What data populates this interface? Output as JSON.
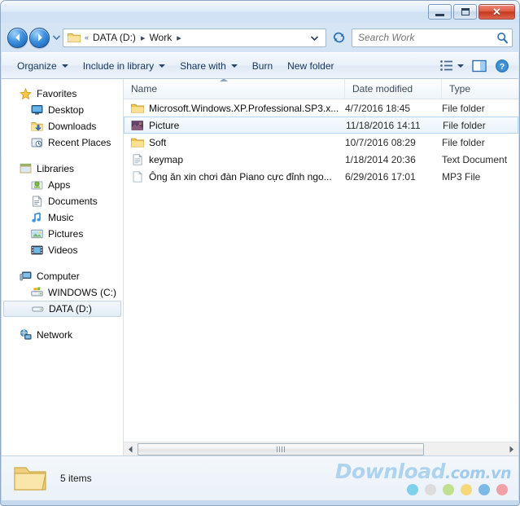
{
  "window": {
    "controls": {
      "minimize": "Minimize",
      "maximize": "Maximize",
      "close": "✕"
    }
  },
  "address": {
    "back_label": "Back",
    "forward_label": "Forward",
    "recent_pages_label": "Recent pages",
    "folder_icon": "folder-icon",
    "overflow": "«",
    "crumbs": [
      {
        "label": "DATA (D:)"
      },
      {
        "label": "Work"
      }
    ],
    "separator": "▸",
    "dropdown_label": "Previous locations",
    "refresh_label": "Refresh"
  },
  "search": {
    "placeholder": "Search Work",
    "value": "",
    "icon": "search-icon"
  },
  "toolbar": {
    "items": [
      {
        "label": "Organize",
        "has_caret": true
      },
      {
        "label": "Include in library",
        "has_caret": true
      },
      {
        "label": "Share with",
        "has_caret": true
      },
      {
        "label": "Burn",
        "has_caret": false
      },
      {
        "label": "New folder",
        "has_caret": false
      }
    ],
    "view_label": "Change your view",
    "preview_label": "Show the preview pane",
    "help_label": "Get help"
  },
  "sidebar": {
    "groups": [
      {
        "header": {
          "label": "Favorites",
          "icon": "star-icon"
        },
        "items": [
          {
            "label": "Desktop",
            "icon": "desktop-icon"
          },
          {
            "label": "Downloads",
            "icon": "downloads-icon"
          },
          {
            "label": "Recent Places",
            "icon": "recent-places-icon"
          }
        ]
      },
      {
        "header": {
          "label": "Libraries",
          "icon": "libraries-icon"
        },
        "items": [
          {
            "label": "Apps",
            "icon": "apps-icon"
          },
          {
            "label": "Documents",
            "icon": "documents-icon"
          },
          {
            "label": "Music",
            "icon": "music-icon"
          },
          {
            "label": "Pictures",
            "icon": "pictures-icon"
          },
          {
            "label": "Videos",
            "icon": "videos-icon"
          }
        ]
      },
      {
        "header": {
          "label": "Computer",
          "icon": "computer-icon"
        },
        "items": [
          {
            "label": "WINDOWS (C:)",
            "icon": "windows-drive-icon",
            "selected": false
          },
          {
            "label": "DATA (D:)",
            "icon": "drive-icon",
            "selected": true
          }
        ]
      },
      {
        "header": {
          "label": "Network",
          "icon": "network-icon"
        },
        "items": []
      }
    ]
  },
  "filelist": {
    "columns": [
      {
        "label": "Name",
        "sorted": "asc"
      },
      {
        "label": "Date modified",
        "sorted": ""
      },
      {
        "label": "Type",
        "sorted": ""
      }
    ],
    "rows": [
      {
        "name": "Microsoft.Windows.XP.Professional.SP3.x...",
        "date": "4/7/2016 18:45",
        "type": "File folder",
        "icon": "folder-icon",
        "selected": false
      },
      {
        "name": "Picture",
        "date": "11/18/2016 14:11",
        "type": "File folder",
        "icon": "picture-folder-icon",
        "selected": true
      },
      {
        "name": "Soft",
        "date": "10/7/2016 08:29",
        "type": "File folder",
        "icon": "folder-icon",
        "selected": false
      },
      {
        "name": "keymap",
        "date": "1/18/2014 20:36",
        "type": "Text Document",
        "icon": "text-document-icon",
        "selected": false
      },
      {
        "name": "Ông ăn xin chơi đàn Piano cực đỉnh ngo...",
        "date": "6/29/2016 17:01",
        "type": "MP3 File",
        "icon": "generic-file-icon",
        "selected": false
      }
    ]
  },
  "scrollbar": {
    "left_arrow": "◂",
    "right_arrow": "▸"
  },
  "status": {
    "item_count": "5 items",
    "icon": "folder-icon"
  },
  "watermark": {
    "brand": "Download",
    "tld": ".com.vn",
    "dots": [
      "#7fd0ec",
      "#dcdcdc",
      "#bfe08f",
      "#f6d87c",
      "#7bb9e6",
      "#f2a0a6"
    ]
  },
  "colors": {
    "accent": "#2a7fd4",
    "close_button": "#c5381f",
    "selection": "#eaf3fb",
    "selection_border": "#b4d4ef"
  }
}
